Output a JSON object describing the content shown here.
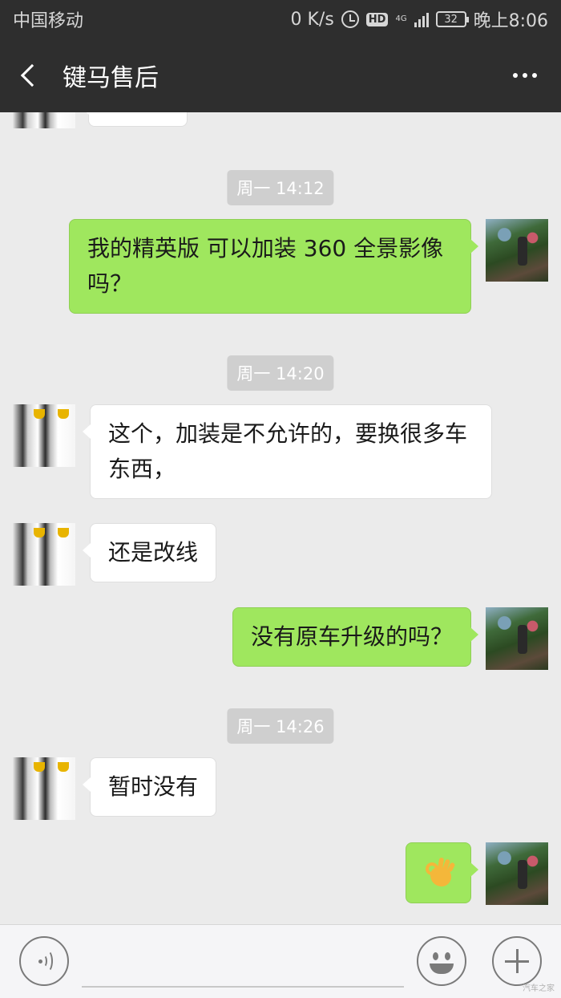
{
  "status_bar": {
    "carrier": "中国移动",
    "speed": "0 K/s",
    "network": "4G",
    "battery": "32",
    "time": "晚上8:06"
  },
  "header": {
    "title": "键马售后",
    "back_icon": "back-arrow-icon",
    "more_icon": "more-dots-icon"
  },
  "messages": [
    {
      "type": "timestamp",
      "text": "周一 14:12"
    },
    {
      "type": "msg",
      "side": "right",
      "text": "我的精英版 可以加装 360 全景影像吗？",
      "avatar": "landscape-avatar"
    },
    {
      "type": "timestamp",
      "text": "周一 14:20"
    },
    {
      "type": "msg",
      "side": "left",
      "text": "这个，加装是不允许的，要换很多车东西，",
      "avatar": "penguin-avatar"
    },
    {
      "type": "msg",
      "side": "left",
      "text": "还是改线",
      "avatar": "penguin-avatar"
    },
    {
      "type": "msg",
      "side": "right",
      "text": "没有原车升级的吗？",
      "avatar": "landscape-avatar"
    },
    {
      "type": "timestamp",
      "text": "周一 14:26"
    },
    {
      "type": "msg",
      "side": "left",
      "text": "暂时没有",
      "avatar": "penguin-avatar"
    },
    {
      "type": "msg",
      "side": "right",
      "emoji": "ok-hand-emoji",
      "avatar": "landscape-avatar"
    }
  ],
  "input_bar": {
    "voice_icon": "voice-icon",
    "emoji_icon": "emoji-icon",
    "plus_icon": "plus-icon",
    "watermark": "汽车之家"
  },
  "colors": {
    "header_bg": "#2e2e2e",
    "chat_bg": "#ebebeb",
    "bubble_sent": "#9fe75e",
    "bubble_received": "#ffffff",
    "timestamp_bg": "#cfcfcf"
  }
}
